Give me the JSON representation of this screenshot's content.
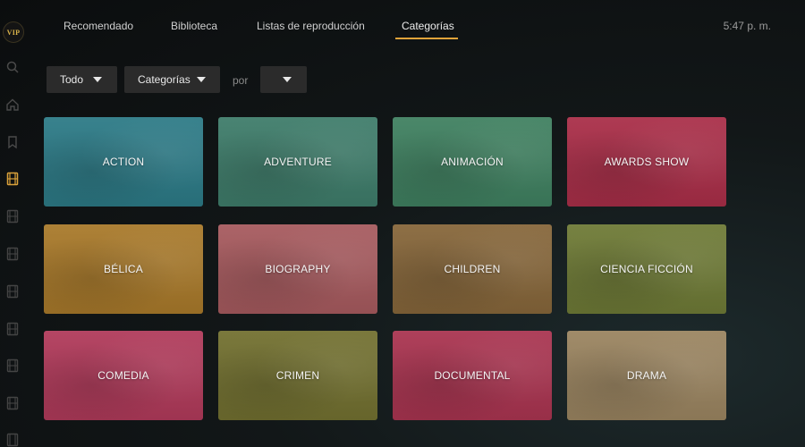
{
  "app": {
    "logo_text": "VIP"
  },
  "sidebar": {
    "icons": [
      "search-icon",
      "home-icon",
      "bookmark-icon",
      "film-icon",
      "film-icon",
      "film-icon",
      "film-icon",
      "film-icon",
      "film-icon",
      "film-icon",
      "film-icon"
    ],
    "active_index": 3
  },
  "nav": {
    "tabs": [
      {
        "label": "Recomendado"
      },
      {
        "label": "Biblioteca"
      },
      {
        "label": "Listas de reproducción"
      },
      {
        "label": "Categorías"
      }
    ],
    "active_tab": "Categorías",
    "clock": "5:47 p. m.",
    "accent_color": "#e0a33a"
  },
  "filters": {
    "type": "Todo",
    "grouping": "Categorías",
    "by_label": "por",
    "sort": ""
  },
  "categories": [
    {
      "label": "ACTION",
      "color": "#2c7a86"
    },
    {
      "label": "ADVENTURE",
      "color": "#3e7c6a"
    },
    {
      "label": "ANIMACIÓN",
      "color": "#3f8060"
    },
    {
      "label": "AWARDS SHOW",
      "color": "#a92e48"
    },
    {
      "label": "BÉLICA",
      "color": "#a8792a"
    },
    {
      "label": "BIOGRAPHY",
      "color": "#a65a5e"
    },
    {
      "label": "CHILDREN",
      "color": "#86663a"
    },
    {
      "label": "CIENCIA FICCIÓN",
      "color": "#6e7a36"
    },
    {
      "label": "COMEDIA",
      "color": "#b03a5a"
    },
    {
      "label": "CRIMEN",
      "color": "#727030"
    },
    {
      "label": "DOCUMENTAL",
      "color": "#a93450"
    },
    {
      "label": "DRAMA",
      "color": "#9a8460"
    }
  ]
}
